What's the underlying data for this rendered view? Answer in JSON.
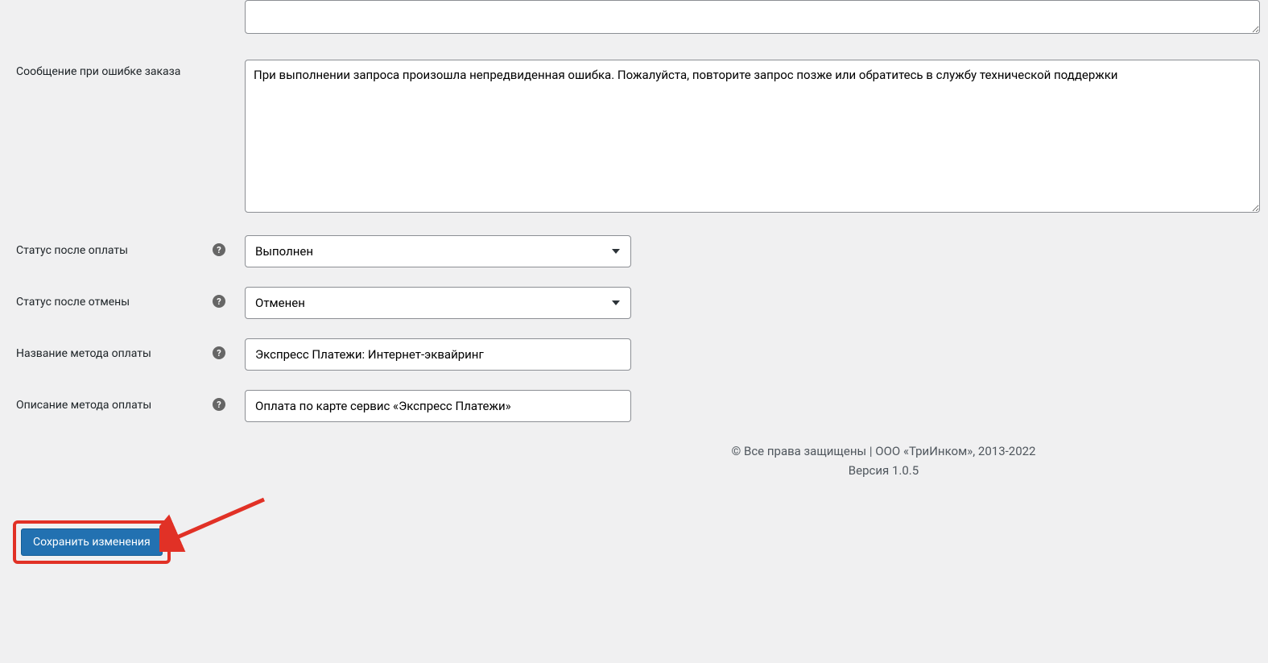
{
  "fields": {
    "error_message": {
      "label": "Сообщение при ошибке заказа",
      "value": "При выполнении запроса произошла непредвиденная ошибка. Пожалуйста, повторите запрос позже или обратитесь в службу технической поддержки"
    },
    "status_after_payment": {
      "label": "Статус после оплаты",
      "value": "Выполнен"
    },
    "status_after_cancel": {
      "label": "Статус после отмены",
      "value": "Отменен"
    },
    "payment_method_name": {
      "label": "Название метода оплаты",
      "value": "Экспресс Платежи: Интернет-эквайринг"
    },
    "payment_method_desc": {
      "label": "Описание метода оплаты",
      "value": "Оплата по карте сервис «Экспресс Платежи»"
    }
  },
  "footer": {
    "copyright": "© Все права защищены | ООО «ТриИнком», 2013-2022",
    "version": "Версия 1.0.5"
  },
  "buttons": {
    "save": "Сохранить изменения"
  },
  "help_char": "?"
}
